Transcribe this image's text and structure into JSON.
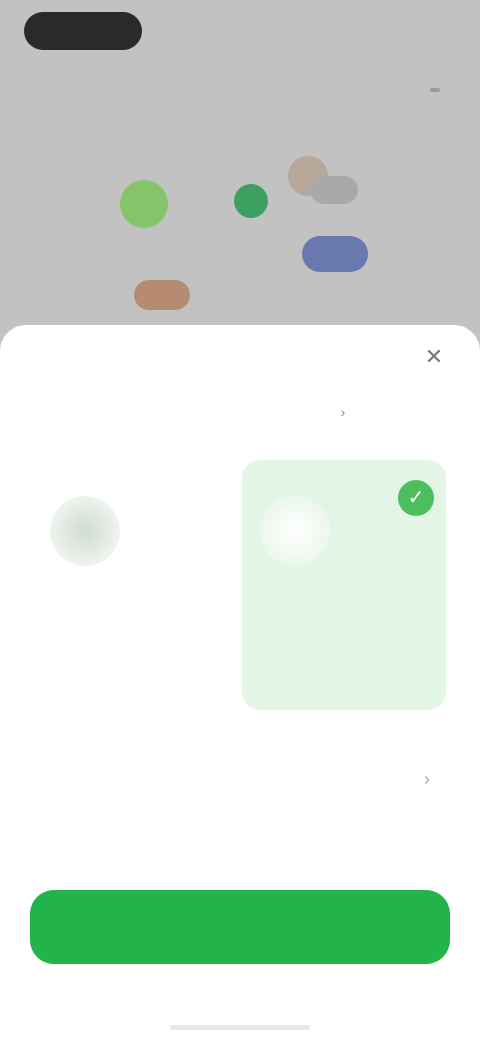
{
  "status": {
    "right_text": ""
  },
  "sheet": {
    "title": "",
    "close_icon": "close-icon"
  },
  "tabs": [
    {
      "label": ""
    },
    {
      "label": ""
    }
  ],
  "cards": [
    {
      "title": "",
      "description": "",
      "selected": false
    },
    {
      "title": "",
      "description": "",
      "selected": true
    }
  ],
  "option": {
    "title": "",
    "subtitle": ""
  },
  "confirm": {
    "label": ""
  },
  "colors": {
    "accent": "#22b34a",
    "selected_bg": "#e3f6e6",
    "check": "#4cbf5c"
  }
}
